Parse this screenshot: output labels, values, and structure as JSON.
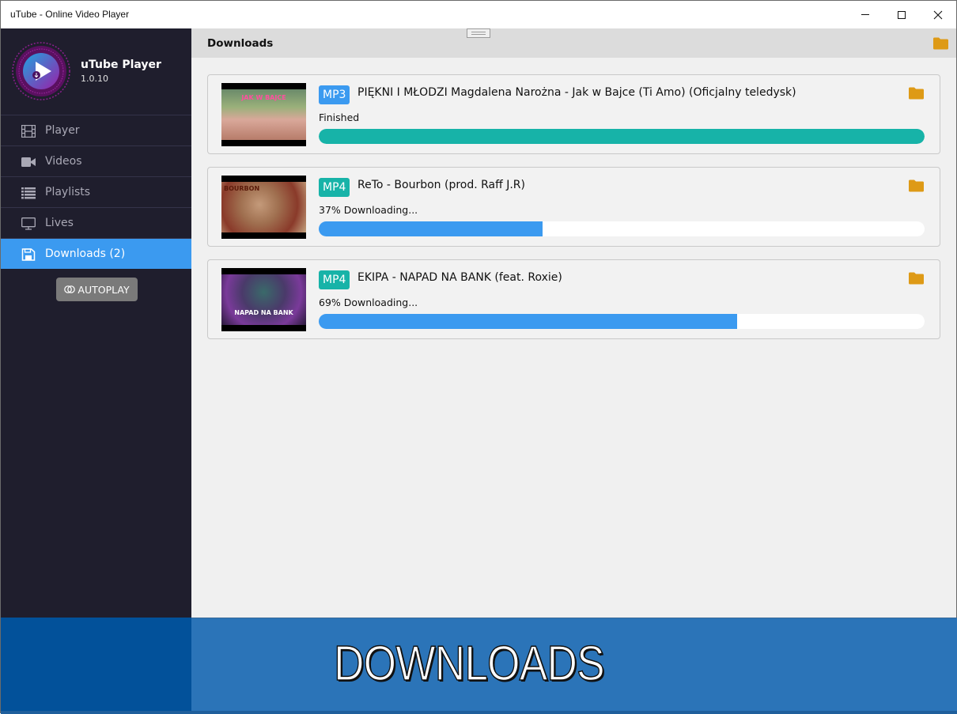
{
  "window": {
    "title": "uTube - Online Video Player",
    "controls": {
      "minimize": "minimize",
      "maximize": "maximize",
      "close": "close"
    }
  },
  "brand": {
    "name": "uTube Player",
    "version": "1.0.10",
    "logo_icon": "play-download-logo"
  },
  "sidebar": {
    "items": [
      {
        "label": "Player",
        "icon": "film-icon",
        "active": false
      },
      {
        "label": "Videos",
        "icon": "video-camera-icon",
        "active": false
      },
      {
        "label": "Playlists",
        "icon": "list-icon",
        "active": false
      },
      {
        "label": "Lives",
        "icon": "monitor-icon",
        "active": false
      },
      {
        "label": "Downloads (2)",
        "icon": "floppy-disk-icon",
        "active": true
      }
    ],
    "autoplay_label": "AUTOPLAY"
  },
  "main": {
    "title": "Downloads",
    "downloads": [
      {
        "format": "MP3",
        "title": "PIĘKNI I MŁODZI Magdalena Narożna - Jak w Bajce (Ti Amo) (Oficjalny teledysk)",
        "status": "Finished",
        "progress": 1.0,
        "thumb_caption": "JAK W BAJCE"
      },
      {
        "format": "MP4",
        "title": "ReTo - Bourbon (prod. Raff J.R)",
        "status": "37% Downloading...",
        "progress": 0.37,
        "thumb_caption": "BOURBON"
      },
      {
        "format": "MP4",
        "title": "EKIPA - NAPAD NA BANK (feat. Roxie)",
        "status": "69% Downloading...",
        "progress": 0.69,
        "thumb_caption": "NAPAD NA BANK"
      }
    ]
  },
  "colors": {
    "sidebar_bg": "#1f1e2d",
    "active_blue": "#3b9af0",
    "teal": "#17b3a8",
    "folder_gold": "#de9a16",
    "banner_blue": "#2b74b8"
  },
  "banner": {
    "text": "DOWNLOADS"
  }
}
